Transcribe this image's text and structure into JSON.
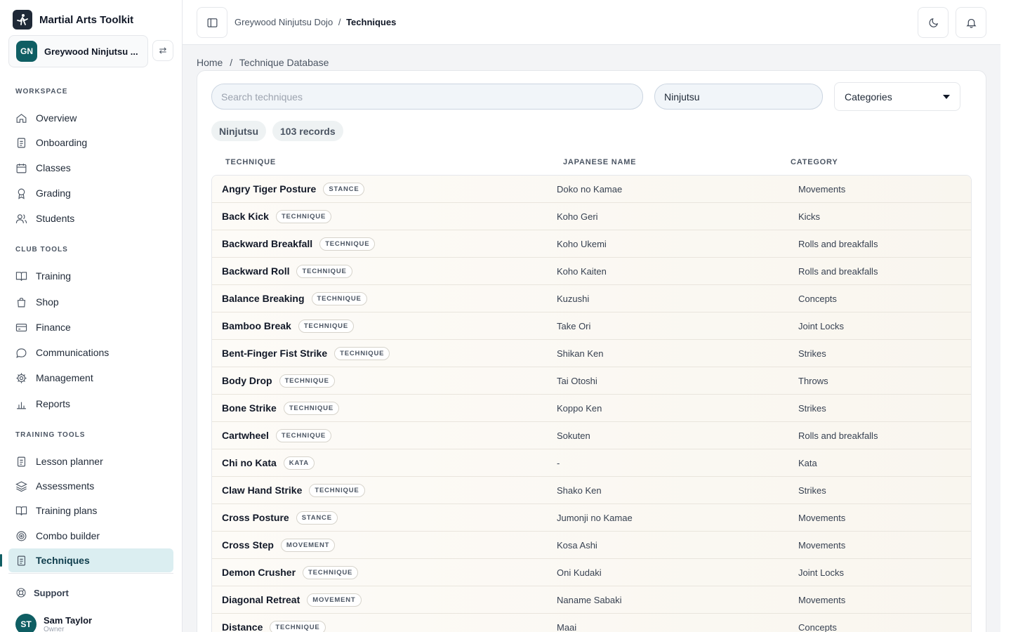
{
  "app": {
    "title": "Martial Arts Toolkit"
  },
  "club": {
    "initials": "GN",
    "name": "Greywood Ninjutsu Dojo",
    "short_name": "Greywood Ninjutsu ..."
  },
  "sidebar": {
    "sections": [
      {
        "title": "WORKSPACE",
        "items": [
          {
            "label": "Overview",
            "icon": "home-icon"
          },
          {
            "label": "Onboarding",
            "icon": "clipboard-icon"
          },
          {
            "label": "Classes",
            "icon": "calendar-icon"
          },
          {
            "label": "Grading",
            "icon": "award-icon"
          },
          {
            "label": "Students",
            "icon": "users-icon"
          }
        ]
      },
      {
        "title": "CLUB TOOLS",
        "items": [
          {
            "label": "Training",
            "icon": "book-icon"
          },
          {
            "label": "Shop",
            "icon": "shopping-bag-icon"
          },
          {
            "label": "Finance",
            "icon": "credit-card-icon"
          },
          {
            "label": "Communications",
            "icon": "message-icon"
          },
          {
            "label": "Management",
            "icon": "gear-icon"
          },
          {
            "label": "Reports",
            "icon": "bar-chart-icon"
          }
        ]
      },
      {
        "title": "TRAINING TOOLS",
        "items": [
          {
            "label": "Lesson planner",
            "icon": "clipboard-icon"
          },
          {
            "label": "Assessments",
            "icon": "layers-icon"
          },
          {
            "label": "Training plans",
            "icon": "book-icon"
          },
          {
            "label": "Combo builder",
            "icon": "target-icon"
          },
          {
            "label": "Techniques",
            "icon": "clipboard-icon",
            "active": true
          }
        ]
      }
    ],
    "support_label": "Support",
    "user": {
      "initials": "ST",
      "name": "Sam Taylor",
      "role": "Owner"
    }
  },
  "header": {
    "crumb_club": "Greywood Ninjutsu Dojo",
    "crumb_sep": "/",
    "crumb_page": "Techniques"
  },
  "breadcrumb": {
    "home": "Home",
    "sep": "/",
    "current": "Technique Database"
  },
  "filters": {
    "search_placeholder": "Search techniques",
    "style_value": "Ninjutsu",
    "category_label": "Categories"
  },
  "chips": {
    "style": "Ninjutsu",
    "records": "103 records"
  },
  "table": {
    "headers": [
      "TECHNIQUE",
      "JAPANESE NAME",
      "CATEGORY"
    ],
    "rows": [
      {
        "name": "Angry Tiger Posture",
        "type": "STANCE",
        "jp": "Doko no Kamae",
        "category": "Movements"
      },
      {
        "name": "Back Kick",
        "type": "TECHNIQUE",
        "jp": "Koho Geri",
        "category": "Kicks"
      },
      {
        "name": "Backward Breakfall",
        "type": "TECHNIQUE",
        "jp": "Koho Ukemi",
        "category": "Rolls and breakfalls"
      },
      {
        "name": "Backward Roll",
        "type": "TECHNIQUE",
        "jp": "Koho Kaiten",
        "category": "Rolls and breakfalls"
      },
      {
        "name": "Balance Breaking",
        "type": "TECHNIQUE",
        "jp": "Kuzushi",
        "category": "Concepts"
      },
      {
        "name": "Bamboo Break",
        "type": "TECHNIQUE",
        "jp": "Take Ori",
        "category": "Joint Locks"
      },
      {
        "name": "Bent-Finger Fist Strike",
        "type": "TECHNIQUE",
        "jp": "Shikan Ken",
        "category": "Strikes"
      },
      {
        "name": "Body Drop",
        "type": "TECHNIQUE",
        "jp": "Tai Otoshi",
        "category": "Throws"
      },
      {
        "name": "Bone Strike",
        "type": "TECHNIQUE",
        "jp": "Koppo Ken",
        "category": "Strikes"
      },
      {
        "name": "Cartwheel",
        "type": "TECHNIQUE",
        "jp": "Sokuten",
        "category": "Rolls and breakfalls"
      },
      {
        "name": "Chi no Kata",
        "type": "KATA",
        "jp": "-",
        "category": "Kata"
      },
      {
        "name": "Claw Hand Strike",
        "type": "TECHNIQUE",
        "jp": "Shako Ken",
        "category": "Strikes"
      },
      {
        "name": "Cross Posture",
        "type": "STANCE",
        "jp": "Jumonji no Kamae",
        "category": "Movements"
      },
      {
        "name": "Cross Step",
        "type": "MOVEMENT",
        "jp": "Kosa Ashi",
        "category": "Movements"
      },
      {
        "name": "Demon Crusher",
        "type": "TECHNIQUE",
        "jp": "Oni Kudaki",
        "category": "Joint Locks"
      },
      {
        "name": "Diagonal Retreat",
        "type": "MOVEMENT",
        "jp": "Naname Sabaki",
        "category": "Movements"
      },
      {
        "name": "Distance",
        "type": "TECHNIQUE",
        "jp": "Maai",
        "category": "Concepts"
      }
    ]
  },
  "colors": {
    "accent": "#0f5e63",
    "active_bg": "#dbeef1"
  }
}
